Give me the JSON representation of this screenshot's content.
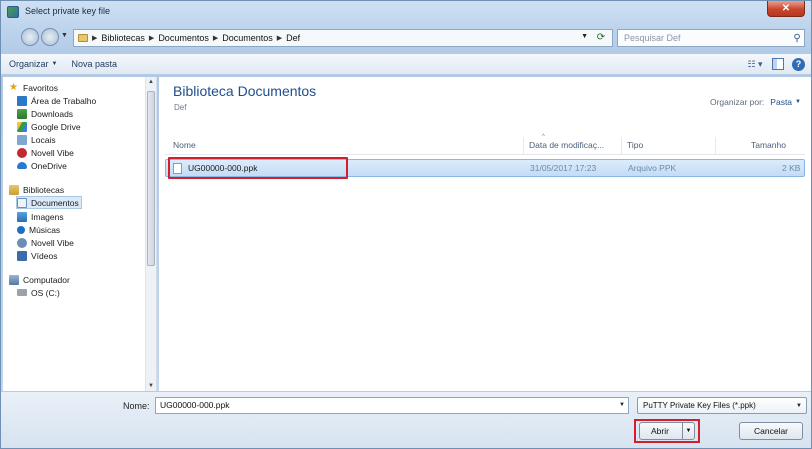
{
  "window": {
    "title": "Select private key file",
    "close_symbol": "✕"
  },
  "address_bar": {
    "breadcrumbs": [
      "Bibliotecas",
      "Documentos",
      "Documentos",
      "Def"
    ],
    "search_placeholder": "Pesquisar Def"
  },
  "toolbar": {
    "organize_label": "Organizar",
    "new_folder_label": "Nova pasta"
  },
  "sidebar": {
    "items": [
      {
        "label": "Favoritos",
        "icon": "star-icon"
      },
      {
        "label": "Área de Trabalho",
        "icon": "desktop-icon"
      },
      {
        "label": "Downloads",
        "icon": "downloads-icon"
      },
      {
        "label": "Google Drive",
        "icon": "google-drive-icon"
      },
      {
        "label": "Locais",
        "icon": "places-icon"
      },
      {
        "label": "Novell Vibe",
        "icon": "novell-vibe-icon"
      },
      {
        "label": "OneDrive",
        "icon": "onedrive-icon"
      },
      {
        "label": "Bibliotecas",
        "icon": "libraries-icon"
      },
      {
        "label": "Documentos",
        "icon": "documents-icon",
        "selected": true
      },
      {
        "label": "Imagens",
        "icon": "images-icon"
      },
      {
        "label": "Músicas",
        "icon": "music-icon"
      },
      {
        "label": "Novell Vibe",
        "icon": "novell-vibe-library-icon"
      },
      {
        "label": "Vídeos",
        "icon": "videos-icon"
      },
      {
        "label": "Computador",
        "icon": "computer-icon"
      },
      {
        "label": "OS (C:)",
        "icon": "drive-icon"
      }
    ]
  },
  "main": {
    "library_title": "Biblioteca Documentos",
    "library_subtitle": "Def",
    "arrange_label": "Organizar por:",
    "arrange_value": "Pasta",
    "columns": [
      "Nome",
      "Data de modificaç...",
      "Tipo",
      "Tamanho"
    ],
    "files": [
      {
        "name": "UG00000-000.ppk",
        "modified": "31/05/2017 17:23",
        "type": "Arquivo PPK",
        "size": "2 KB"
      }
    ]
  },
  "footer": {
    "filename_label": "Nome:",
    "filename_value": "UG00000-000.ppk",
    "filetype_value": "PuTTY Private Key Files (*.ppk)",
    "open_label": "Abrir",
    "cancel_label": "Cancelar"
  },
  "colors": {
    "highlight": "#d11f2b",
    "accent": "#1f4e8c",
    "selection": "#c3dcf5"
  }
}
